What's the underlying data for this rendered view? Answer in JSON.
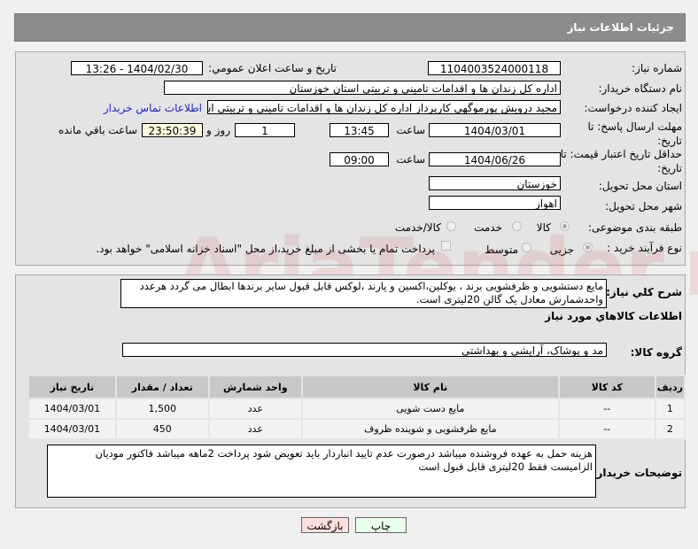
{
  "header": {
    "title": "جزئیات اطلاعات نیاز"
  },
  "fields": {
    "need_number_label": "شماره نیاز:",
    "need_number": "1104003524000118",
    "announce_label": "تاریخ و ساعت اعلان عمومي:",
    "announce_value": "1404/02/30 - 13:26",
    "buyer_org_label": "نام دستگاه خریدار:",
    "buyer_org": "اداره کل زندان ها و اقدامات تامینی و تربیتی استان خوزستان",
    "creator_label": "ایجاد کننده درخواست:",
    "creator": "مجید درویش پورموگهی کارپرداز اداره کل زندان ها و اقدامات تامینی و تربیتی است",
    "contact_link": "اطلاعات تماس خریدار",
    "deadline_label": "مهلت ارسال پاسخ: تا تاریخ:",
    "deadline_date": "1404/03/01",
    "time_label": "ساعت",
    "deadline_time": "13:45",
    "days": "1",
    "days_label": "روز و",
    "remaining": "23:50:39",
    "remaining_label": "ساعت باقي مانده",
    "validity_label": "حداقل تاریخ اعتبار قیمت: تا تاریخ:",
    "validity_date": "1404/06/26",
    "validity_time": "09:00",
    "province_label": "استان محل تحویل:",
    "province": "خوزستان",
    "city_label": "شهر محل تحویل:",
    "city": "اهواز",
    "category_label": "طبقه بندی موضوعی:",
    "category_options": [
      "کالا",
      "خدمت",
      "کالا/خدمت"
    ],
    "process_label": "نوع فرآیند خرید :",
    "process_options": [
      "جزیی",
      "متوسط"
    ],
    "payment_note": "پرداخت تمام یا بخشی از مبلغ خرید،از محل \"اسناد خزانه اسلامی\" خواهد بود."
  },
  "details": {
    "desc_label": "شرح کلي نیاز:",
    "desc": "مایع دستشویی و ظرفشویی برند ، یوکلین،اکسین و پارند ،لوکس قابل قبول سایر برندها ابطال می گردد هرعدد واحدشمارش معادل یک گالن 20لیتری است.",
    "goods_title": "اطلاعات کالاهاي مورد نیاز",
    "group_label": "گروه کالا:",
    "group": "مد و پوشاک، آرایشی و بهداشتی",
    "columns": [
      "ردیف",
      "کد کالا",
      "نام کالا",
      "واحد شمارش",
      "تعداد / مقدار",
      "تاریخ نیاز"
    ],
    "rows": [
      [
        "1",
        "--",
        "مایع دست شویی",
        "عدد",
        "1,500",
        "1404/03/01"
      ],
      [
        "2",
        "--",
        "مایع ظرفشویی و شوینده ظروف",
        "عدد",
        "450",
        "1404/03/01"
      ]
    ],
    "notes_label": "توضیحات خریدار:",
    "notes": "هزینه حمل به عهده فروشنده میباشد درصورت عدم تایید انباردار باید تعویض شود پرداخت 2ماهه میباشد فاکتور مودیان الزامیست فقط 20لیتری قابل قبول است"
  },
  "buttons": {
    "print": "چاپ",
    "back": "بازگشت"
  },
  "watermark": "AriaTender.net"
}
